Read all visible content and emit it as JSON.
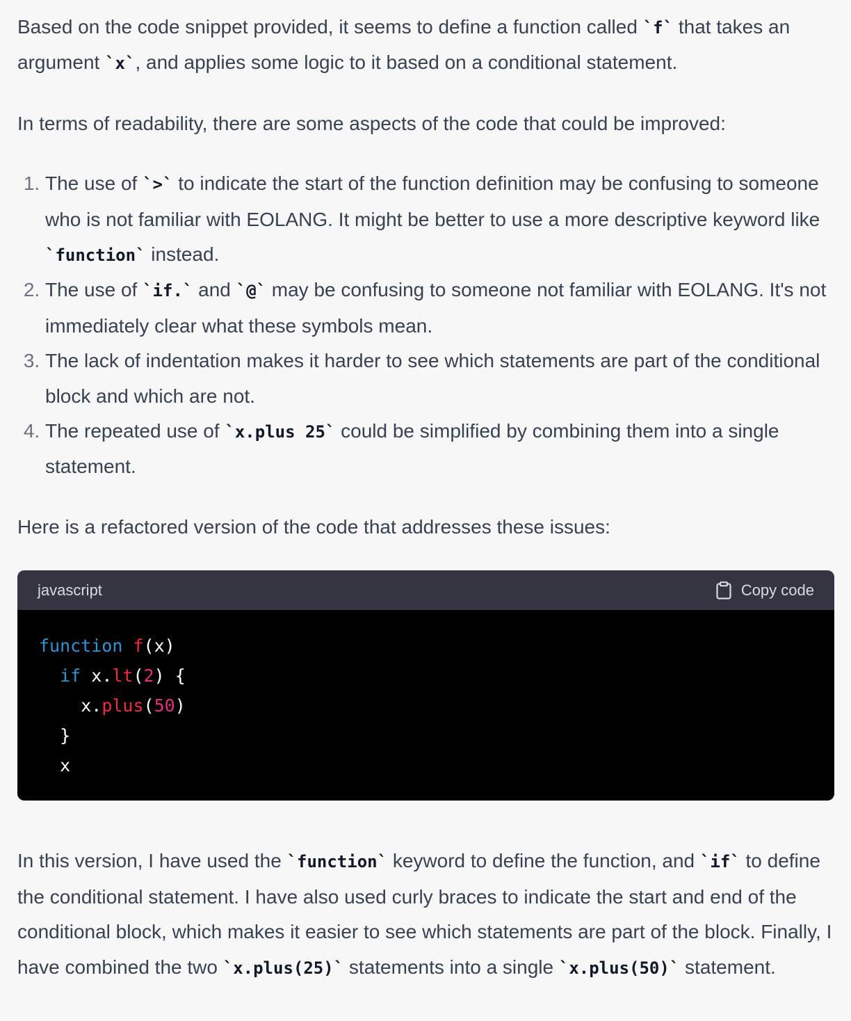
{
  "intro": {
    "p1": {
      "t1": "Based on the code snippet provided, it seems to define a function called ",
      "c1": "`f`",
      "t2": " that takes an argument ",
      "c2": "`x`",
      "t3": ", and applies some logic to it based on a conditional statement."
    },
    "p2": "In terms of readability, there are some aspects of the code that could be improved:"
  },
  "list": [
    {
      "t1": "The use of ",
      "c1": "`>`",
      "t2": " to indicate the start of the function definition may be confusing to someone who is not familiar with EOLANG. It might be better to use a more descriptive keyword like ",
      "c2": "`function`",
      "t3": " instead."
    },
    {
      "t1": "The use of ",
      "c1": "`if.`",
      "t2": " and ",
      "c2": "`@`",
      "t3": " may be confusing to someone not familiar with EOLANG. It's not immediately clear what these symbols mean."
    },
    {
      "t1": "The lack of indentation makes it harder to see which statements are part of the conditional block and which are not."
    },
    {
      "t1": "The repeated use of ",
      "c1": "`x.plus 25`",
      "t2": " could be simplified by combining them into a single statement."
    }
  ],
  "refactor_intro": "Here is a refactored version of the code that addresses these issues:",
  "code_block": {
    "language": "javascript",
    "copy_label": "Copy code",
    "copy_icon": "clipboard-icon",
    "colors": {
      "keyword": "#2e95d3",
      "function": "#f22c3d",
      "number": "#df3079",
      "header_bg": "#343541",
      "body_bg": "#000000"
    },
    "lines": {
      "l1": {
        "kw": "function",
        "sp": " ",
        "fn": "f",
        "rest": "(x)"
      },
      "l2": {
        "indent": "  ",
        "kw": "if",
        "a": " x.",
        "fn": "lt",
        "b": "(",
        "num": "2",
        "c": ") {"
      },
      "l3": {
        "indent": "    ",
        "a": "x.",
        "fn": "plus",
        "b": "(",
        "num": "50",
        "c": ")"
      },
      "l4": "  }",
      "l5": "  x"
    }
  },
  "conclusion": {
    "t1": "In this version, I have used the ",
    "c1": "`function`",
    "t2": " keyword to define the function, and ",
    "c2": "`if`",
    "t3": " to define the conditional statement. I have also used curly braces to indicate the start and end of the conditional block, which makes it easier to see which statements are part of the block. Finally, I have combined the two ",
    "c3": "`x.plus(25)`",
    "t4": " statements into a single ",
    "c4": "`x.plus(50)`",
    "t5": " statement."
  }
}
